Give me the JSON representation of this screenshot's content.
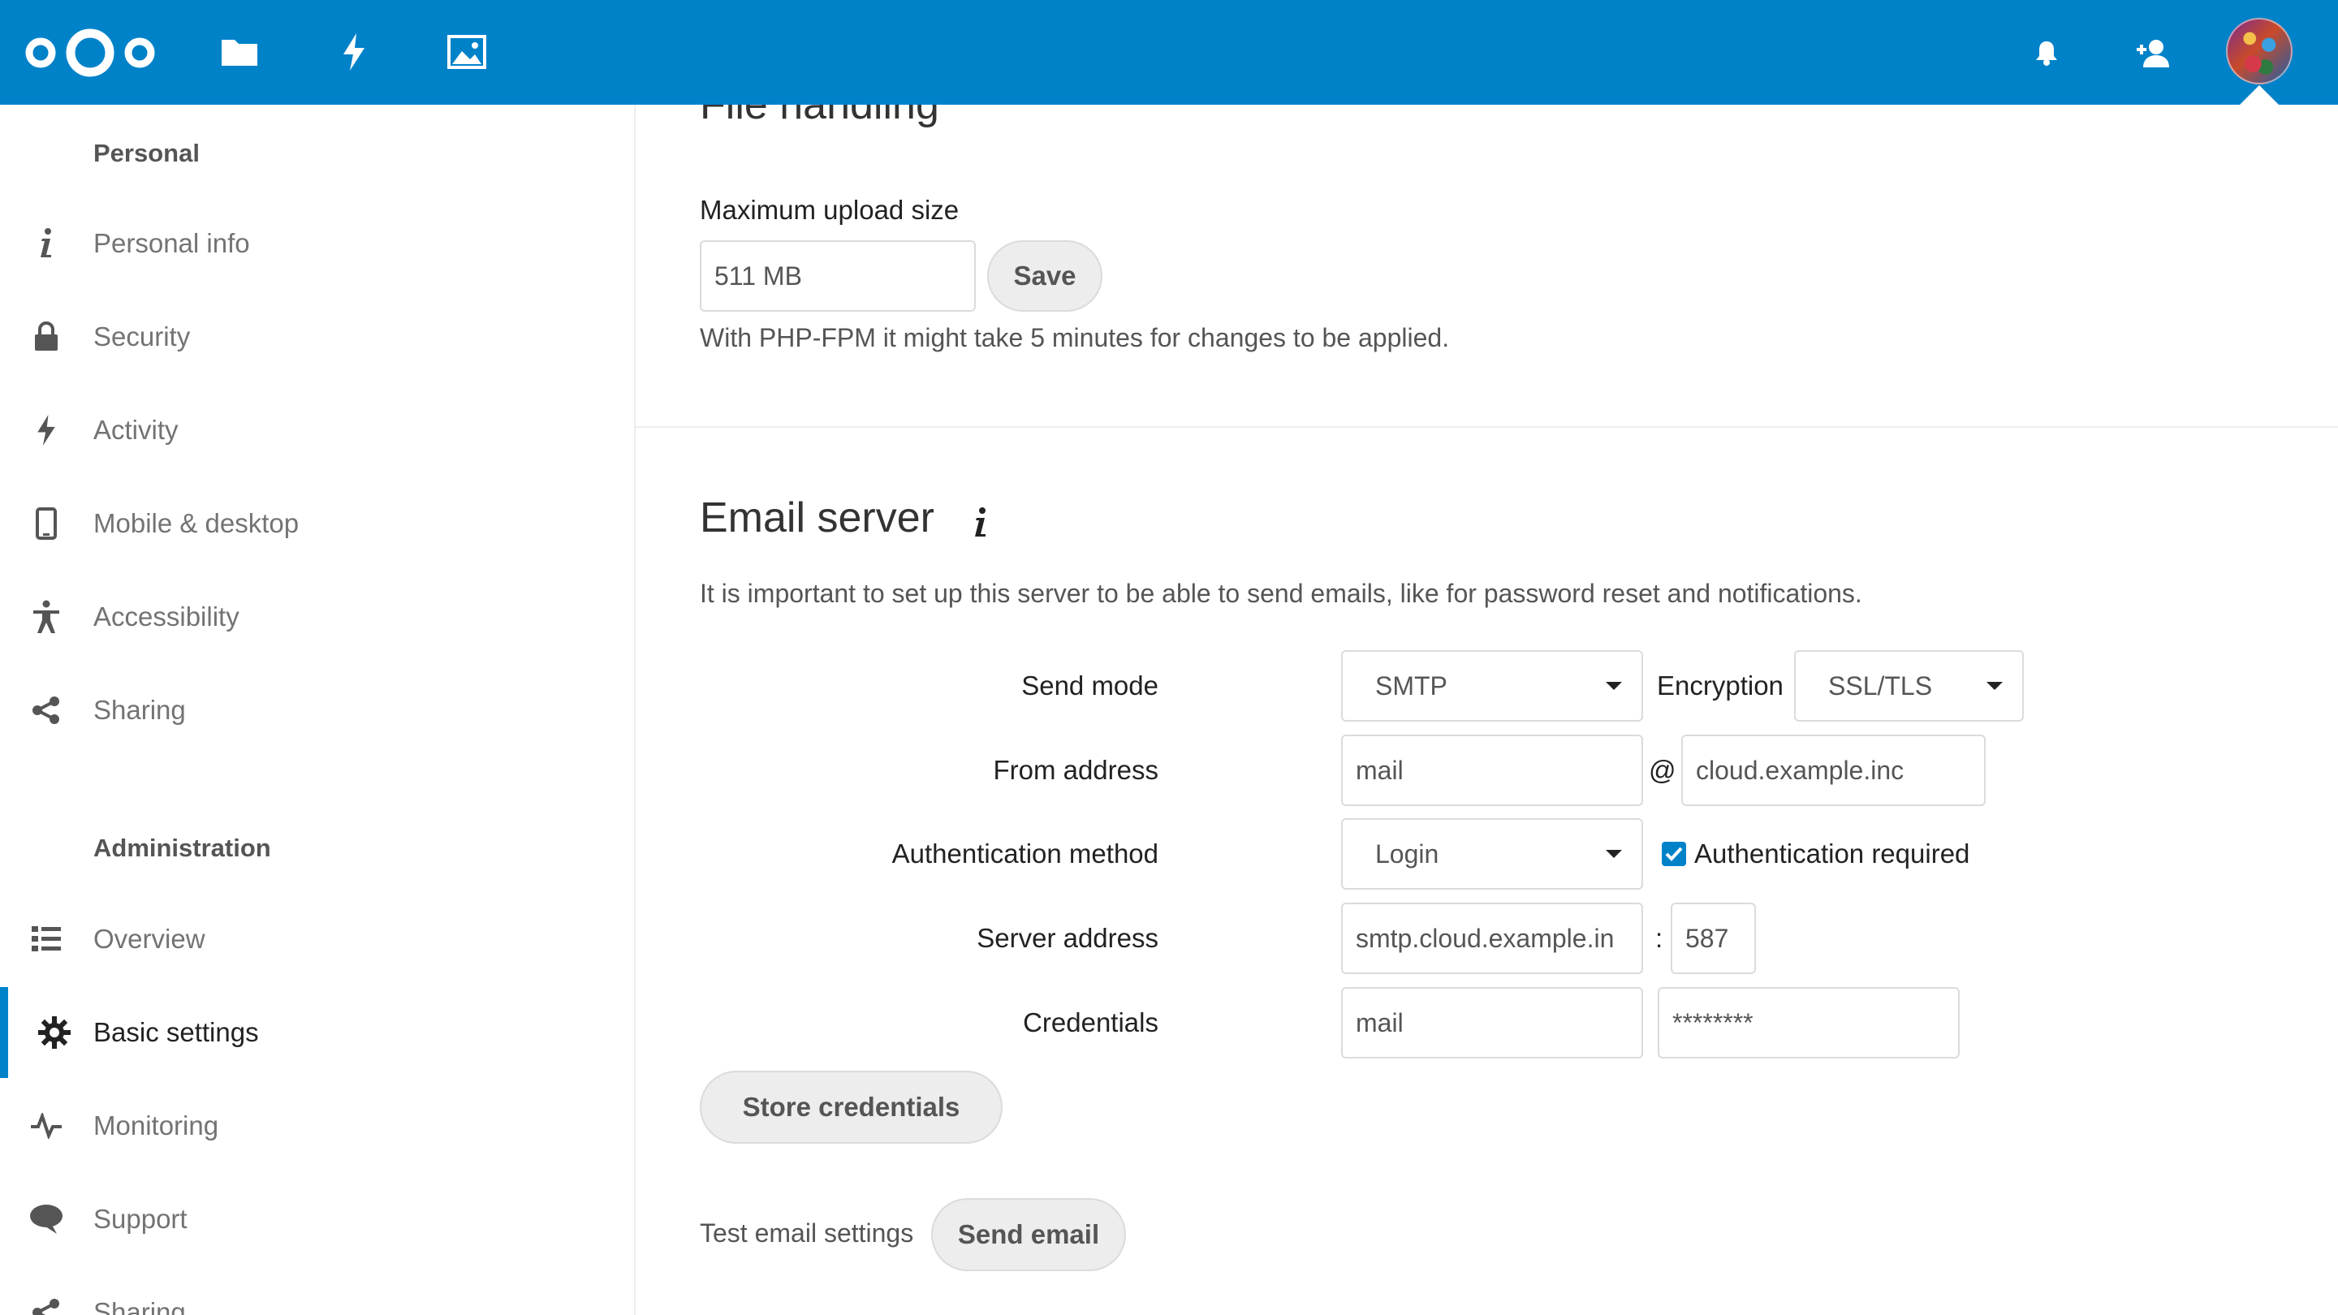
{
  "header": {
    "icons": [
      "nextcloud-logo",
      "files-icon",
      "activity-icon",
      "photos-icon",
      "notifications-icon",
      "contacts-icon",
      "avatar"
    ],
    "accent_color": "#0082c9"
  },
  "sidebar": {
    "personal_caption": "Personal",
    "personal_items": [
      {
        "label": "Personal info",
        "icon": "info-icon"
      },
      {
        "label": "Security",
        "icon": "lock-icon"
      },
      {
        "label": "Activity",
        "icon": "activity-icon"
      },
      {
        "label": "Mobile & desktop",
        "icon": "phone-icon"
      },
      {
        "label": "Accessibility",
        "icon": "accessibility-icon"
      },
      {
        "label": "Sharing",
        "icon": "share-icon"
      }
    ],
    "admin_caption": "Administration",
    "admin_items": [
      {
        "label": "Overview",
        "icon": "list-icon"
      },
      {
        "label": "Basic settings",
        "icon": "gear-icon",
        "active": true
      },
      {
        "label": "Monitoring",
        "icon": "pulse-icon"
      },
      {
        "label": "Support",
        "icon": "chat-icon"
      },
      {
        "label": "Sharing",
        "icon": "share-icon"
      }
    ]
  },
  "file_handling": {
    "title": "File handling",
    "upload_label": "Maximum upload size",
    "upload_value": "511 MB",
    "save_label": "Save",
    "note": "With PHP-FPM it might take 5 minutes for changes to be applied."
  },
  "email": {
    "title": "Email server",
    "description": "It is important to set up this server to be able to send emails, like for password reset and notifications.",
    "send_mode_label": "Send mode",
    "send_mode_value": "SMTP",
    "encryption_label": "Encryption",
    "encryption_value": "SSL/TLS",
    "from_label": "From address",
    "from_user": "mail",
    "at": "@",
    "from_domain": "cloud.example.inc",
    "auth_method_label": "Authentication method",
    "auth_method_value": "Login",
    "auth_required_label": "Authentication required",
    "auth_required_checked": true,
    "server_label": "Server address",
    "server_value": "smtp.cloud.example.in",
    "colon": ":",
    "port_value": "587",
    "credentials_label": "Credentials",
    "credentials_user": "mail",
    "credentials_password": "********",
    "store_label": "Store credentials",
    "test_label": "Test email settings",
    "send_label": "Send email"
  }
}
